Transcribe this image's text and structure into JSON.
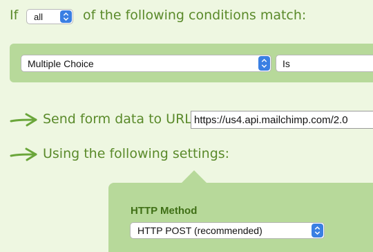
{
  "conditions": {
    "if_label": "If",
    "match_mode": "all",
    "match_text": "of the following conditions match:",
    "rule": {
      "field": "Multiple Choice",
      "operator": "Is"
    }
  },
  "actions": {
    "send_label": "Send form data to URL:",
    "url_value": "https://us4.api.mailchimp.com/2.0",
    "using_label": "Using the following settings:"
  },
  "settings": {
    "http_method_label": "HTTP Method",
    "http_method_value": "HTTP POST (recommended)"
  },
  "colors": {
    "background": "#eef7e1",
    "panel": "#b7d99a",
    "text_green": "#5a8a2a",
    "select_accent": "#3a7fe3"
  },
  "icons": {
    "action_arrow": "arrow-right-icon",
    "select_arrows": "updown-chevron-icon"
  }
}
